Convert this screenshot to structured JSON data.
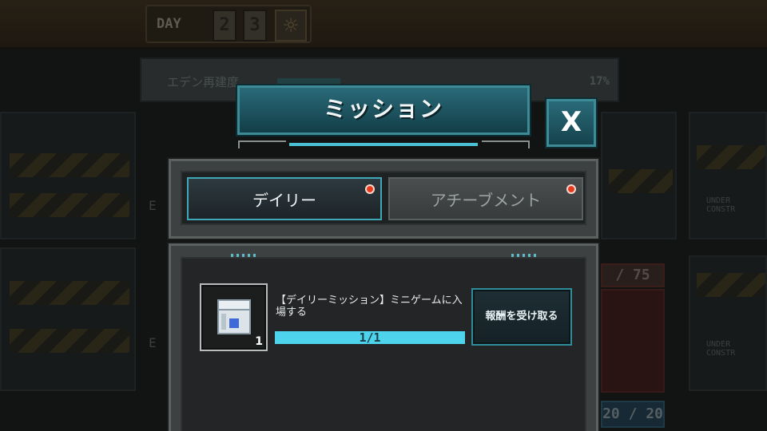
{
  "topbar": {
    "day_label": "DAY",
    "day_digits": [
      "2",
      "3"
    ],
    "weather_icon": "sun-icon"
  },
  "progress": {
    "label": "エデン再建度",
    "percent_text": "17%",
    "fill_fraction": 0.22
  },
  "background_rooms": {
    "left_texts": [
      "E",
      "E"
    ],
    "right_texts": [
      "UNDER\nCONSTR",
      "UNDER\nCONSTR"
    ],
    "counters": [
      "/ 75",
      "20 / 20"
    ]
  },
  "dialog": {
    "title": "ミッション",
    "close_label": "X",
    "tabs": [
      {
        "label": "デイリー",
        "active": true,
        "has_notification": true
      },
      {
        "label": "アチーブメント",
        "active": false,
        "has_notification": true
      }
    ],
    "missions": [
      {
        "title": "【デイリーミッション】ミニゲームに入場する",
        "reward_icon": "crate-icon",
        "reward_count": "1",
        "progress_text": "1/1",
        "progress_fraction": 1.0,
        "claim_label": "報酬を受け取る"
      }
    ]
  },
  "colors": {
    "accent": "#4bc0d2",
    "banner": "#2a6a78",
    "notification": "#e83a1c",
    "progress_fill": "#4dd3ec"
  }
}
